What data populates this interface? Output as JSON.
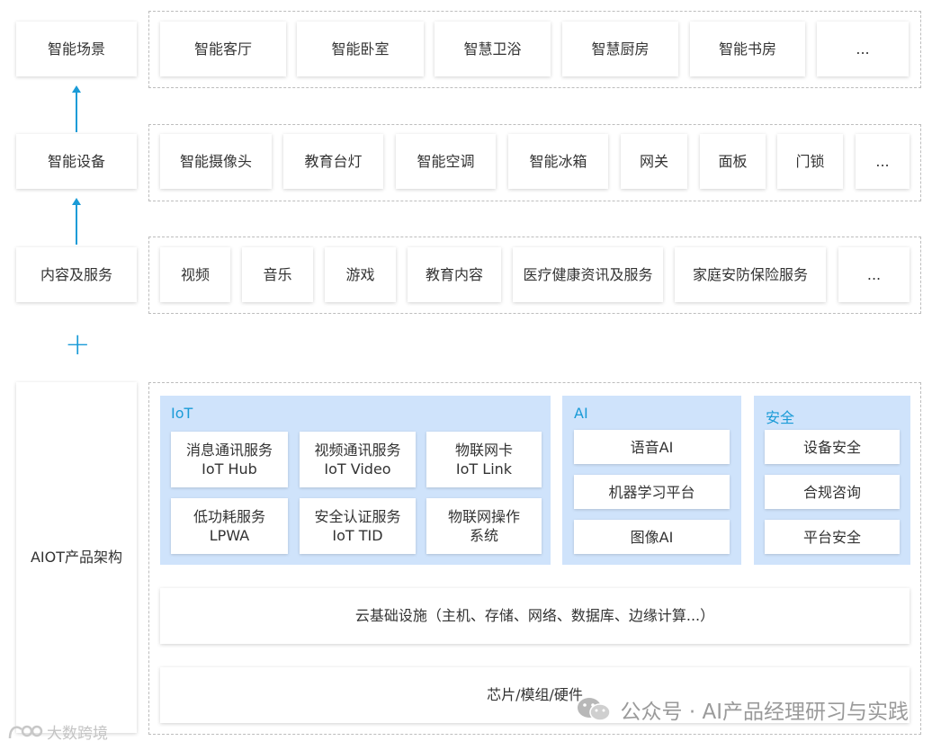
{
  "left_labels": {
    "scene": "智能场景",
    "device": "智能设备",
    "content": "内容及服务",
    "arch": "AIOT产品架构"
  },
  "plus_sign": "+",
  "scenes": [
    "智能客厅",
    "智能卧室",
    "智慧卫浴",
    "智慧厨房",
    "智能书房",
    "..."
  ],
  "devices": [
    "智能摄像头",
    "教育台灯",
    "智能空调",
    "智能冰箱",
    "网关",
    "面板",
    "门锁",
    "..."
  ],
  "services": [
    "视频",
    "音乐",
    "游戏",
    "教育内容",
    "医疗健康资讯及服务",
    "家庭安防保险服务",
    "..."
  ],
  "iot": {
    "title": "IoT",
    "items": [
      {
        "line1": "消息通讯服务",
        "line2": "IoT Hub"
      },
      {
        "line1": "视频通讯服务",
        "line2": "IoT Video"
      },
      {
        "line1": "物联网卡",
        "line2": "IoT Link"
      },
      {
        "line1": "低功耗服务",
        "line2": "LPWA"
      },
      {
        "line1": "安全认证服务",
        "line2": "IoT TID"
      },
      {
        "line1": "物联网操作",
        "line2": "系统"
      }
    ]
  },
  "ai": {
    "title": "AI",
    "items": [
      "语音AI",
      "机器学习平台",
      "图像AI"
    ]
  },
  "security": {
    "title": "安全",
    "items": [
      "设备安全",
      "合规咨询",
      "平台安全"
    ]
  },
  "cloud": "云基础设施（主机、存储、网络、数据库、边缘计算...）",
  "chip": "芯片/模组/硬件",
  "watermark": {
    "right": "公众号 · AI产品经理研习与实践",
    "left": "大数跨境"
  },
  "colors": {
    "accent": "#1a9bd7",
    "panel": "#cfe3fb"
  }
}
